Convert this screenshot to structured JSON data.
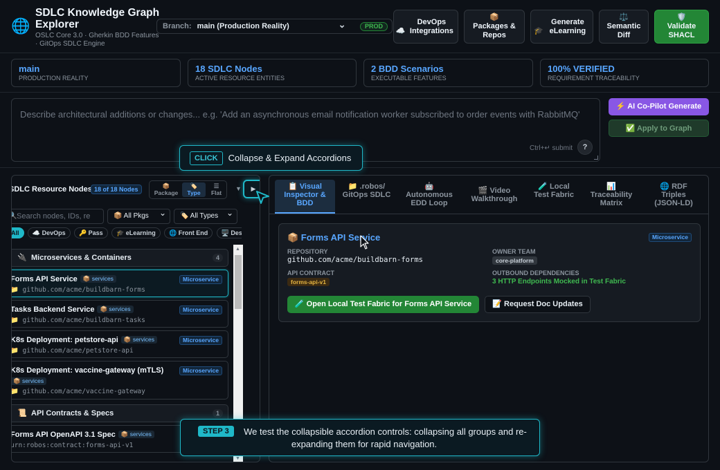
{
  "header": {
    "title": "SDLC Knowledge Graph Explorer",
    "subtitle": "OSLC Core 3.0 · Gherkin BDD Features · GitOps SDLC Engine",
    "branch_label": "Branch:",
    "branch_value": "main (Production Reality)",
    "env_badge": "PROD",
    "buttons": [
      {
        "icon": "☁️",
        "label": "DevOps Integrations"
      },
      {
        "icon": "📦",
        "label": "Packages & Repos"
      },
      {
        "icon": "🎓",
        "label": "Generate eLearning"
      },
      {
        "icon": "⚖️",
        "label": "Semantic Diff"
      },
      {
        "icon": "🛡️",
        "label": "Validate SHACL"
      }
    ]
  },
  "stats": [
    {
      "value": "main",
      "label": "Production Reality"
    },
    {
      "value": "18 SDLC Nodes",
      "label": "Active Resource Entities"
    },
    {
      "value": "2 BDD Scenarios",
      "label": "Executable Features"
    },
    {
      "value": "100% VERIFIED",
      "label": "Requirement Traceability"
    }
  ],
  "prompt": {
    "placeholder": "Describe architectural additions or changes... e.g. 'Add an asynchronous email notification worker subscribed to order events with RabbitMQ'",
    "hint": "Ctrl+↵ submit",
    "help": "?",
    "ai_button": "⚡ AI Co-Pilot Generate",
    "apply_button": "✅ Apply to Graph"
  },
  "click_tip": {
    "tag": "CLICK",
    "text": "Collapse & Expand Accordions"
  },
  "left_panel": {
    "title": "SDLC Resource Nodes",
    "count": "18 of 18 Nodes",
    "views": [
      {
        "icon": "📦",
        "label": "Package"
      },
      {
        "icon": "🏷️",
        "label": "Type"
      },
      {
        "icon": "☰",
        "label": "Flat"
      }
    ],
    "caret": "▼",
    "play": "▶",
    "search_placeholder": "Search nodes, IDs, re",
    "pkg_filter": "📦 All Pkgs",
    "type_filter": "🏷️ All Types",
    "chips": [
      "All",
      "☁️ DevOps",
      "🔑 Pass",
      "🎓 eLearning",
      "🌐 Front End",
      "🖥️ Des"
    ],
    "groups": [
      {
        "icon": "🔌",
        "title": "Microservices & Containers",
        "count": "4"
      },
      {
        "icon": "📜",
        "title": "API Contracts & Specs",
        "count": "1"
      }
    ],
    "nodes": [
      {
        "name": "Forms API Service",
        "pkg": "📦 services",
        "kind": "Microservice",
        "path": "📁 github.com/acme/buildbarn-forms"
      },
      {
        "name": "Tasks Backend Service",
        "pkg": "📦 services",
        "kind": "Microservice",
        "path": "📁 github.com/acme/buildbarn-tasks"
      },
      {
        "name": "K8s Deployment: petstore-api",
        "pkg": "📦 services",
        "kind": "Microservice",
        "path": "📁 github.com/acme/petstore-api"
      },
      {
        "name": "K8s Deployment: vaccine-gateway (mTLS)",
        "pkg": "📦 services",
        "kind": "Microservice",
        "path": "📁 github.com/acme/vaccine-gateway"
      },
      {
        "name": "Forms API OpenAPI 3.1 Spec",
        "pkg": "📦 services",
        "kind": "",
        "path": "urn:robos:contract:forms-api-v1"
      }
    ]
  },
  "right_panel": {
    "tabs": [
      {
        "icon": "📋",
        "label": "Visual Inspector & BDD"
      },
      {
        "icon": "📁",
        "label": ".robos/ GitOps SDLC"
      },
      {
        "icon": "🤖",
        "label": "Autonomous EDD Loop"
      },
      {
        "icon": "🎬",
        "label": "Video Walkthrough"
      },
      {
        "icon": "🧪",
        "label": "Local Test Fabric"
      },
      {
        "icon": "📊",
        "label": "Traceability Matrix"
      },
      {
        "icon": "🌐",
        "label": "RDF Triples (JSON-LD)"
      }
    ],
    "detail": {
      "title": "📦 Forms API Service",
      "kind": "Microservice",
      "repo_label": "Repository",
      "repo": "github.com/acme/buildbarn-forms",
      "owner_label": "Owner Team",
      "owner": "core-platform",
      "contract_label": "API Contract",
      "contract": "forms-api-v1",
      "deps_label": "Outbound Dependencies",
      "deps": "3 HTTP Endpoints Mocked in Test Fabric",
      "btn_fabric": "🧪 Open Local Test Fabric for Forms API Service",
      "btn_docs": "📝 Request Doc Updates"
    }
  },
  "step_tip": {
    "tag": "STEP 3",
    "text": "We test the collapsible accordion controls: collapsing all groups and re-expanding them for rapid navigation."
  },
  "colors": {
    "background": "#0d1117",
    "accent": "#58a6ff",
    "teal_highlight": "#1fb8c8",
    "success": "#238636",
    "ai_purple": "#8957e5"
  }
}
